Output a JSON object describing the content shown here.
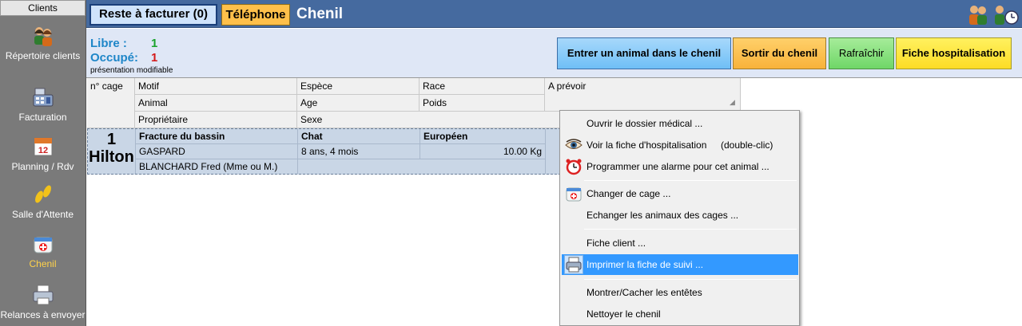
{
  "sidebar": {
    "header": "Clients",
    "items": [
      {
        "label": "Répertoire clients",
        "icon": "people-icon"
      },
      {
        "label": "Facturation",
        "icon": "cash-register-icon"
      },
      {
        "label": "Planning / Rdv",
        "icon": "calendar-icon",
        "calendar_day": "12"
      },
      {
        "label": "Salle d'Attente",
        "icon": "footprints-icon"
      },
      {
        "label": "Chenil",
        "icon": "kennel-icon",
        "active": true
      },
      {
        "label": "Relances à envoyer",
        "icon": "printer-icon"
      }
    ]
  },
  "topbar": {
    "reste_label": "Reste à facturer (0)",
    "telephone_label": "Téléphone",
    "title": "Chenil"
  },
  "toolbar": {
    "libre_label": "Libre :",
    "libre_value": "1",
    "occupe_label": "Occupé:",
    "occupe_value": "1",
    "presentation": "présentation modifiable",
    "buttons": {
      "entrer": "Entrer un animal dans le chenil",
      "sortir": "Sortir du chenil",
      "rafraichir": "Rafraîchir",
      "fiche": "Fiche hospitalisation"
    }
  },
  "table": {
    "headers": {
      "cage": "n° cage",
      "motif": "Motif",
      "espece": "Espèce",
      "race": "Race",
      "a_prevoir": "A prévoir",
      "animal": "Animal",
      "age": "Age",
      "poids": "Poids",
      "proprietaire": "Propriétaire",
      "sexe": "Sexe"
    },
    "rows": [
      {
        "cage_number": "1",
        "cage_name": "Hilton",
        "motif": "Fracture du bassin",
        "espece": "Chat",
        "race": "Européen",
        "animal": "GASPARD",
        "age": "8 ans, 4 mois",
        "poids": "10.00 Kg",
        "proprietaire": "BLANCHARD Fred (Mme ou M.)",
        "sexe": ""
      }
    ]
  },
  "context_menu": {
    "items": [
      {
        "label": "Ouvrir le dossier médical ...",
        "icon": ""
      },
      {
        "label": "Voir la fiche d'hospitalisation",
        "shortcut": "(double-clic)",
        "icon": "eye-icon"
      },
      {
        "label": "Programmer une alarme pour cet animal ...",
        "icon": "alarm-clock-icon"
      },
      {
        "label": "Changer de cage ...",
        "icon": "kennel-icon"
      },
      {
        "label": "Echanger les animaux des cages ...",
        "icon": ""
      },
      {
        "label": "Fiche client ...",
        "icon": ""
      },
      {
        "label": "Imprimer la fiche de suivi ...",
        "icon": "printer-icon",
        "highlighted": true
      },
      {
        "label": "Montrer/Cacher les entêtes",
        "icon": ""
      },
      {
        "label": "Nettoyer le chenil",
        "icon": ""
      }
    ]
  },
  "colors": {
    "topbar_bg": "#456a9f",
    "sidebar_bg": "#7a7a7a",
    "toolbar_bg": "#dfe7f6",
    "libre_label": "#1e86c8",
    "libre_value": "#1aa32c",
    "occupe_value": "#d41a1a",
    "row_selected": "#c9d6e6",
    "menu_highlight": "#3399ff"
  }
}
